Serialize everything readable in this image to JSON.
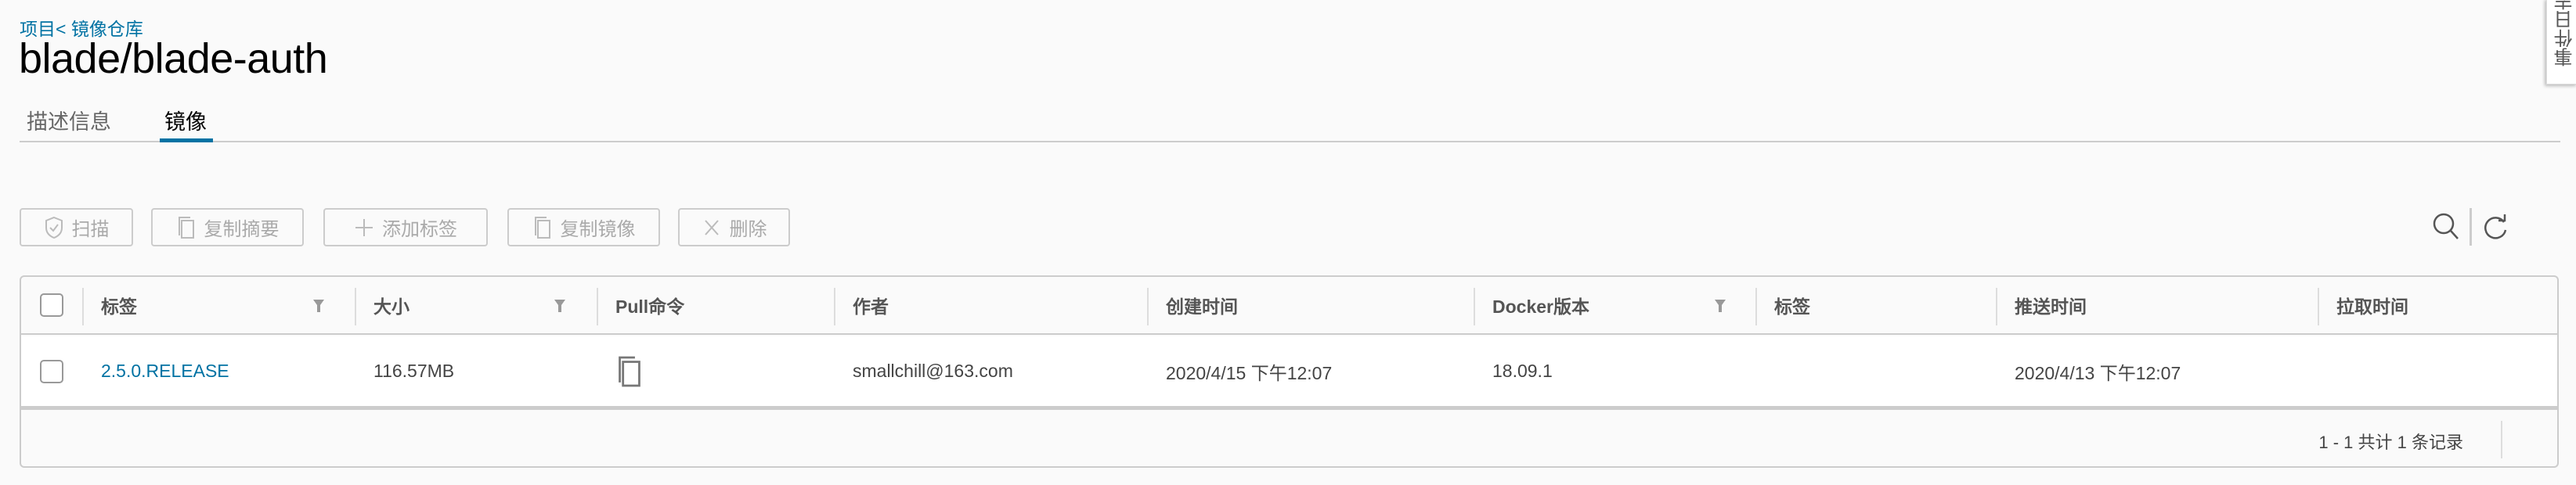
{
  "breadcrumb": "项目< 镜像仓库",
  "title": "blade/blade-auth",
  "tabs": [
    {
      "label": "描述信息"
    },
    {
      "label": "镜像"
    }
  ],
  "toolbar": {
    "scan": "扫描",
    "copy_digest": "复制摘要",
    "add_label": "添加标签",
    "copy_image": "复制镜像",
    "delete": "删除"
  },
  "side_tab": "事件日志",
  "table": {
    "columns": [
      "标签",
      "大小",
      "Pull命令",
      "作者",
      "创建时间",
      "Docker版本",
      "标签",
      "推送时间",
      "拉取时间"
    ],
    "rows": [
      {
        "tag": "2.5.0.RELEASE",
        "size": "116.57MB",
        "pull": "",
        "author": "smallchill@163.com",
        "created": "2020/4/15 下午12:07",
        "docker_version": "18.09.1",
        "labels": "",
        "pushed": "2020/4/13 下午12:07",
        "pulled": ""
      }
    ],
    "pagination": "1 - 1 共计 1 条记录"
  },
  "colors": {
    "accent": "#0072a3",
    "border": "#cccccc",
    "background": "#fafafa"
  }
}
